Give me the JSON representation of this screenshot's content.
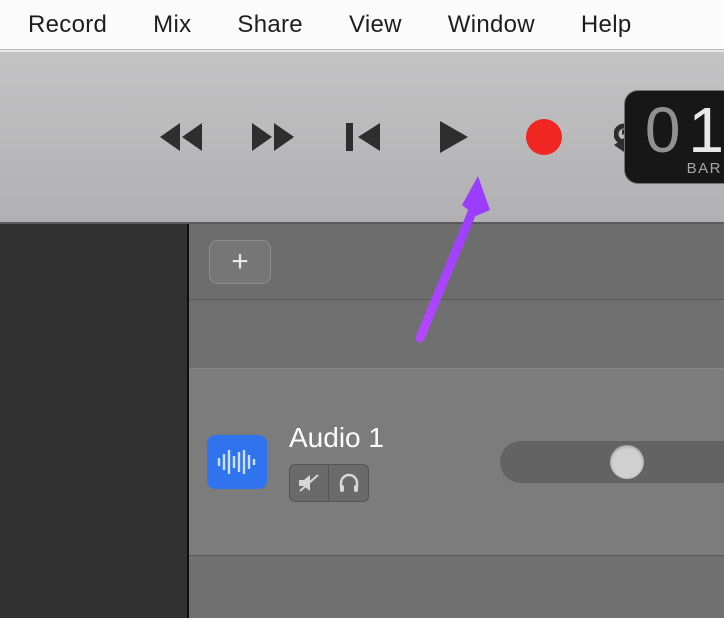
{
  "menu": {
    "items": [
      "Record",
      "Mix",
      "Share",
      "View",
      "Window",
      "Help"
    ]
  },
  "lcd": {
    "digit1": "0",
    "digit2": "1",
    "label": "BAR"
  },
  "add_track": {
    "plus": "+"
  },
  "track": {
    "name": "Audio 1"
  }
}
